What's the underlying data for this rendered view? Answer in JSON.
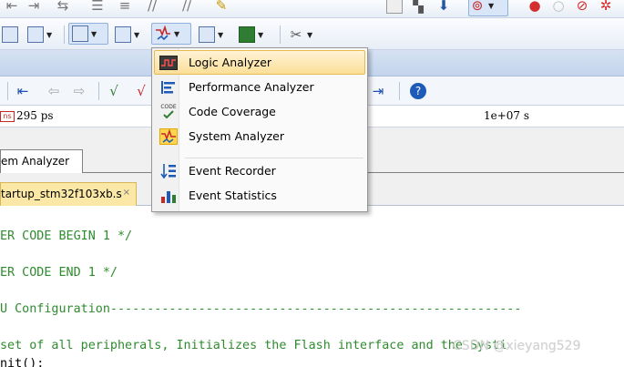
{
  "timeline": {
    "unit_badge": "ns",
    "left_value": "295 ps",
    "right_value": "1e+07 s"
  },
  "tabs": {
    "system_analyzer": "em Analyzer",
    "file_tab": "tartup_stm32f103xb.s",
    "file_close": "×"
  },
  "menu": {
    "items": [
      {
        "label": "Logic Analyzer",
        "icon": "logic-analyzer-icon"
      },
      {
        "label": "Performance Analyzer",
        "icon": "performance-analyzer-icon"
      },
      {
        "label": "Code Coverage",
        "icon": "code-coverage-icon",
        "icon_text": "CODE"
      },
      {
        "label": "System Analyzer",
        "icon": "system-analyzer-icon"
      },
      {
        "label": "Event Recorder",
        "icon": "event-recorder-icon"
      },
      {
        "label": "Event Statistics",
        "icon": "event-statistics-icon"
      }
    ]
  },
  "code": {
    "lines": [
      "ER CODE BEGIN 1 */",
      "ER CODE END 1 */",
      "U Configuration--------------------------------------------------------",
      "set of all peripherals, Initializes the Flash interface and the Systi",
      "nit();"
    ]
  },
  "watermark": "CSDN @xieyang529",
  "colors": {
    "comment_green": "#2e8b2e",
    "highlight": "#fbdf98",
    "toolbar_band": "#c3d4ec"
  }
}
